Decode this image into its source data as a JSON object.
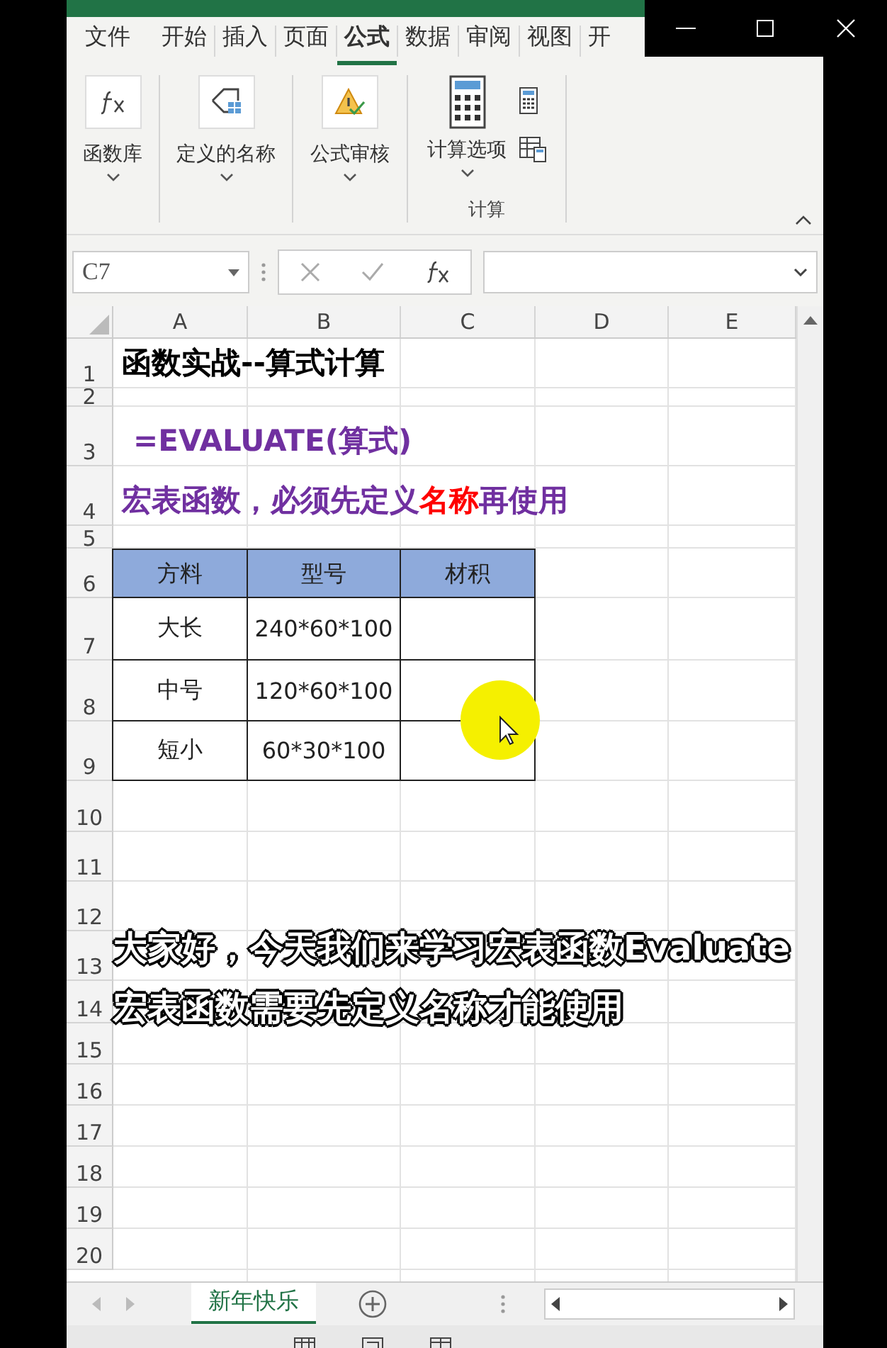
{
  "ribbon_tabs": [
    {
      "label": "文件",
      "selected": false
    },
    {
      "label": "开始",
      "selected": false
    },
    {
      "label": "插入",
      "selected": false
    },
    {
      "label": "页面",
      "selected": false
    },
    {
      "label": "公式",
      "selected": true
    },
    {
      "label": "数据",
      "selected": false
    },
    {
      "label": "审阅",
      "selected": false
    },
    {
      "label": "视图",
      "selected": false
    },
    {
      "label": "开",
      "selected": false
    }
  ],
  "ribbon_groups": [
    {
      "kind": "function",
      "label": "函数库"
    },
    {
      "kind": "names",
      "label": "定义的名称"
    },
    {
      "kind": "audit",
      "label": "公式审核"
    },
    {
      "kind": "calc",
      "label": "计算选项",
      "group_label": "计算"
    }
  ],
  "name_box": "C7",
  "sheet": {
    "columns": [
      "A",
      "B",
      "C",
      "D",
      "E"
    ],
    "row_numbers": [
      "1",
      "2",
      "3",
      "4",
      "5",
      "6",
      "7",
      "8",
      "9",
      "10",
      "11",
      "12",
      "13",
      "14",
      "15",
      "16",
      "17",
      "18",
      "19",
      "20"
    ],
    "title": "函数实战--算式计算",
    "formula": "=EVALUATE(算式)",
    "note": [
      {
        "text": "宏表函数，必须先定义",
        "color": "#7030a0"
      },
      {
        "text": "名称",
        "color": "#ff0000"
      },
      {
        "text": "再使用",
        "color": "#7030a0"
      }
    ],
    "table": {
      "header": [
        "方料",
        "型号",
        "材积"
      ],
      "rows": [
        [
          "大长",
          "240*60*100"
        ],
        [
          "中号",
          "120*60*100"
        ],
        [
          "短小",
          "60*30*100"
        ]
      ]
    }
  },
  "sheet_tabs": [
    {
      "label": "新年快乐",
      "selected": true
    }
  ],
  "captions": [
    "大家好，今天我们来学习宏表函数Evaluate",
    "宏表函数需要先定义名称才能使用"
  ]
}
